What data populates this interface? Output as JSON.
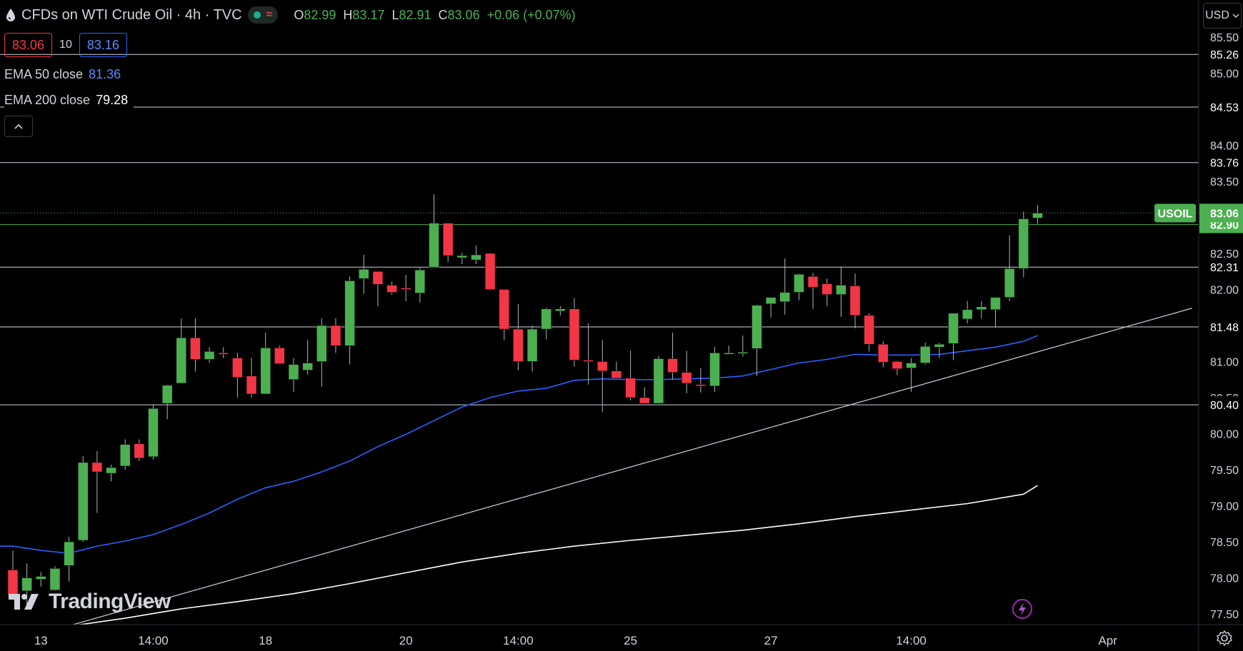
{
  "header": {
    "title": "CFDs on WTI Crude Oil · 4h · TVC",
    "ohlc": {
      "o_label": "O",
      "o": "82.99",
      "h_label": "H",
      "h": "83.17",
      "l_label": "L",
      "l": "82.91",
      "c_label": "C",
      "c": "83.06",
      "change": "+0.06 (+0.07%)"
    }
  },
  "quote": {
    "sell": "83.06",
    "spread": "10",
    "buy": "83.16"
  },
  "indicators": [
    {
      "label": "EMA 50 close",
      "value": "81.36",
      "color": "#2962ff"
    },
    {
      "label": "EMA 200 close",
      "value": "79.28",
      "color": "#ffffff"
    }
  ],
  "currency": "USD",
  "logo": "TradingView",
  "colors": {
    "up": "#4caf50",
    "down": "#f23645",
    "ema50": "#2962ff",
    "ema200": "#ffffff",
    "background": "#000000",
    "price_label": "#4caf50"
  },
  "chart_data": {
    "type": "candlestick",
    "x_ticks": [
      "13",
      "14:00",
      "18",
      "20",
      "14:00",
      "25",
      "27",
      "14:00",
      "Apr"
    ],
    "y_ticks": [
      "85.50",
      "85.00",
      "84.00",
      "83.50",
      "82.50",
      "82.00",
      "81.00",
      "80.50",
      "80.00",
      "79.50",
      "79.00",
      "78.50",
      "78.00",
      "77.50"
    ],
    "ylim": [
      77.3,
      85.9
    ],
    "horizontal_levels": [
      "85.26",
      "84.53",
      "83.76",
      "82.31",
      "81.48",
      "80.40"
    ],
    "current_price": {
      "symbol": "USOIL",
      "value": "83.06"
    },
    "highlight_level": "82.90",
    "candles": [
      [
        78.11,
        78.38,
        77.78,
        77.76
      ],
      [
        77.82,
        78.2,
        77.56,
        78.0
      ],
      [
        77.98,
        78.08,
        77.88,
        78.02
      ],
      [
        77.83,
        78.16,
        77.82,
        78.13
      ],
      [
        78.17,
        78.57,
        77.95,
        78.5
      ],
      [
        78.52,
        79.69,
        78.5,
        79.6
      ],
      [
        79.6,
        79.76,
        78.9,
        79.47
      ],
      [
        79.45,
        79.57,
        79.34,
        79.53
      ],
      [
        79.55,
        79.92,
        79.5,
        79.85
      ],
      [
        79.86,
        79.92,
        79.62,
        79.66
      ],
      [
        79.68,
        80.4,
        79.64,
        80.35
      ],
      [
        80.42,
        80.68,
        80.2,
        80.67
      ],
      [
        80.7,
        81.6,
        80.7,
        81.33
      ],
      [
        81.33,
        81.6,
        80.86,
        81.03
      ],
      [
        81.03,
        81.2,
        80.98,
        81.14
      ],
      [
        81.12,
        81.2,
        81.05,
        81.1
      ],
      [
        81.05,
        81.12,
        80.5,
        80.78
      ],
      [
        80.8,
        81.05,
        80.5,
        80.55
      ],
      [
        80.55,
        81.4,
        80.55,
        81.19
      ],
      [
        81.19,
        81.22,
        80.97,
        80.97
      ],
      [
        80.75,
        81.05,
        80.58,
        80.96
      ],
      [
        80.88,
        81.3,
        80.82,
        80.98
      ],
      [
        81.0,
        81.6,
        80.65,
        81.5
      ],
      [
        81.5,
        81.6,
        81.12,
        81.22
      ],
      [
        81.22,
        82.18,
        80.96,
        82.12
      ],
      [
        82.15,
        82.48,
        81.94,
        82.28
      ],
      [
        82.25,
        82.24,
        81.77,
        82.07
      ],
      [
        82.06,
        82.11,
        81.93,
        81.96
      ],
      [
        82.02,
        82.2,
        81.84,
        82.0
      ],
      [
        81.95,
        82.3,
        81.82,
        82.27
      ],
      [
        82.31,
        83.32,
        82.31,
        82.92
      ],
      [
        82.92,
        82.92,
        82.38,
        82.47
      ],
      [
        82.44,
        82.51,
        82.35,
        82.47
      ],
      [
        82.41,
        82.61,
        82.35,
        82.48
      ],
      [
        82.5,
        82.51,
        81.99,
        82.0
      ],
      [
        82.0,
        82.0,
        81.3,
        81.45
      ],
      [
        81.45,
        81.8,
        80.88,
        81.0
      ],
      [
        81.0,
        81.5,
        80.86,
        81.45
      ],
      [
        81.45,
        81.75,
        81.31,
        81.73
      ],
      [
        81.7,
        81.77,
        81.64,
        81.73
      ],
      [
        81.73,
        81.88,
        80.93,
        81.02
      ],
      [
        81.02,
        81.53,
        80.68,
        81.0
      ],
      [
        81.0,
        81.3,
        80.3,
        80.87
      ],
      [
        80.87,
        81.0,
        80.77,
        80.77
      ],
      [
        80.77,
        81.15,
        80.46,
        80.5
      ],
      [
        80.5,
        80.64,
        80.42,
        80.42
      ],
      [
        80.42,
        81.08,
        80.42,
        81.04
      ],
      [
        81.04,
        81.4,
        80.75,
        80.85
      ],
      [
        80.85,
        81.15,
        80.56,
        80.7
      ],
      [
        80.68,
        80.91,
        80.57,
        80.66
      ],
      [
        80.66,
        81.2,
        80.58,
        81.12
      ],
      [
        81.12,
        81.22,
        81.1,
        81.12
      ],
      [
        81.12,
        81.36,
        81.07,
        81.13
      ],
      [
        81.18,
        81.79,
        80.8,
        81.78
      ],
      [
        81.8,
        81.88,
        81.61,
        81.89
      ],
      [
        81.83,
        82.43,
        81.65,
        81.96
      ],
      [
        81.96,
        82.22,
        81.85,
        82.21
      ],
      [
        82.18,
        82.23,
        81.73,
        82.03
      ],
      [
        82.08,
        82.15,
        81.77,
        81.93
      ],
      [
        81.93,
        82.32,
        81.62,
        82.06
      ],
      [
        82.05,
        82.22,
        81.46,
        81.64
      ],
      [
        81.64,
        81.67,
        81.14,
        81.24
      ],
      [
        81.24,
        81.28,
        80.92,
        80.99
      ],
      [
        81.0,
        81.01,
        80.81,
        80.9
      ],
      [
        80.91,
        81.05,
        80.58,
        80.98
      ],
      [
        80.98,
        81.26,
        80.96,
        81.21
      ],
      [
        81.2,
        81.26,
        81.05,
        81.24
      ],
      [
        81.25,
        81.6,
        81.02,
        81.67
      ],
      [
        81.59,
        81.84,
        81.53,
        81.72
      ],
      [
        81.72,
        81.84,
        81.6,
        81.76
      ],
      [
        81.72,
        81.89,
        81.47,
        81.89
      ],
      [
        81.89,
        82.75,
        81.84,
        82.29
      ],
      [
        82.29,
        83.08,
        82.17,
        82.98
      ],
      [
        82.99,
        83.17,
        82.91,
        83.06
      ]
    ],
    "ema50": [
      [
        0,
        78.44
      ],
      [
        2,
        78.38
      ],
      [
        4,
        78.34
      ],
      [
        6,
        78.44
      ],
      [
        8,
        78.51
      ],
      [
        10,
        78.6
      ],
      [
        12,
        78.74
      ],
      [
        14,
        78.9
      ],
      [
        16,
        79.09
      ],
      [
        18,
        79.25
      ],
      [
        20,
        79.34
      ],
      [
        22,
        79.47
      ],
      [
        24,
        79.62
      ],
      [
        26,
        79.82
      ],
      [
        28,
        79.99
      ],
      [
        30,
        80.18
      ],
      [
        32,
        80.37
      ],
      [
        34,
        80.5
      ],
      [
        36,
        80.59
      ],
      [
        38,
        80.63
      ],
      [
        40,
        80.74
      ],
      [
        42,
        80.76
      ],
      [
        44,
        80.75
      ],
      [
        46,
        80.75
      ],
      [
        48,
        80.76
      ],
      [
        50,
        80.77
      ],
      [
        52,
        80.8
      ],
      [
        54,
        80.89
      ],
      [
        56,
        80.98
      ],
      [
        58,
        81.03
      ],
      [
        60,
        81.1
      ],
      [
        62,
        81.09
      ],
      [
        64,
        81.09
      ],
      [
        66,
        81.1
      ],
      [
        68,
        81.15
      ],
      [
        70,
        81.2
      ],
      [
        72,
        81.28
      ],
      [
        73,
        81.36
      ]
    ],
    "ema200": [
      [
        4,
        77.33
      ],
      [
        8,
        77.44
      ],
      [
        12,
        77.57
      ],
      [
        16,
        77.67
      ],
      [
        20,
        77.78
      ],
      [
        24,
        77.92
      ],
      [
        28,
        78.07
      ],
      [
        32,
        78.22
      ],
      [
        36,
        78.34
      ],
      [
        40,
        78.44
      ],
      [
        44,
        78.52
      ],
      [
        48,
        78.59
      ],
      [
        52,
        78.66
      ],
      [
        56,
        78.75
      ],
      [
        60,
        78.85
      ],
      [
        64,
        78.94
      ],
      [
        68,
        79.03
      ],
      [
        72,
        79.16
      ],
      [
        73,
        79.28
      ]
    ],
    "trendline": {
      "from": [
        3,
        77.28
      ],
      "to": [
        84,
        81.74
      ]
    }
  }
}
